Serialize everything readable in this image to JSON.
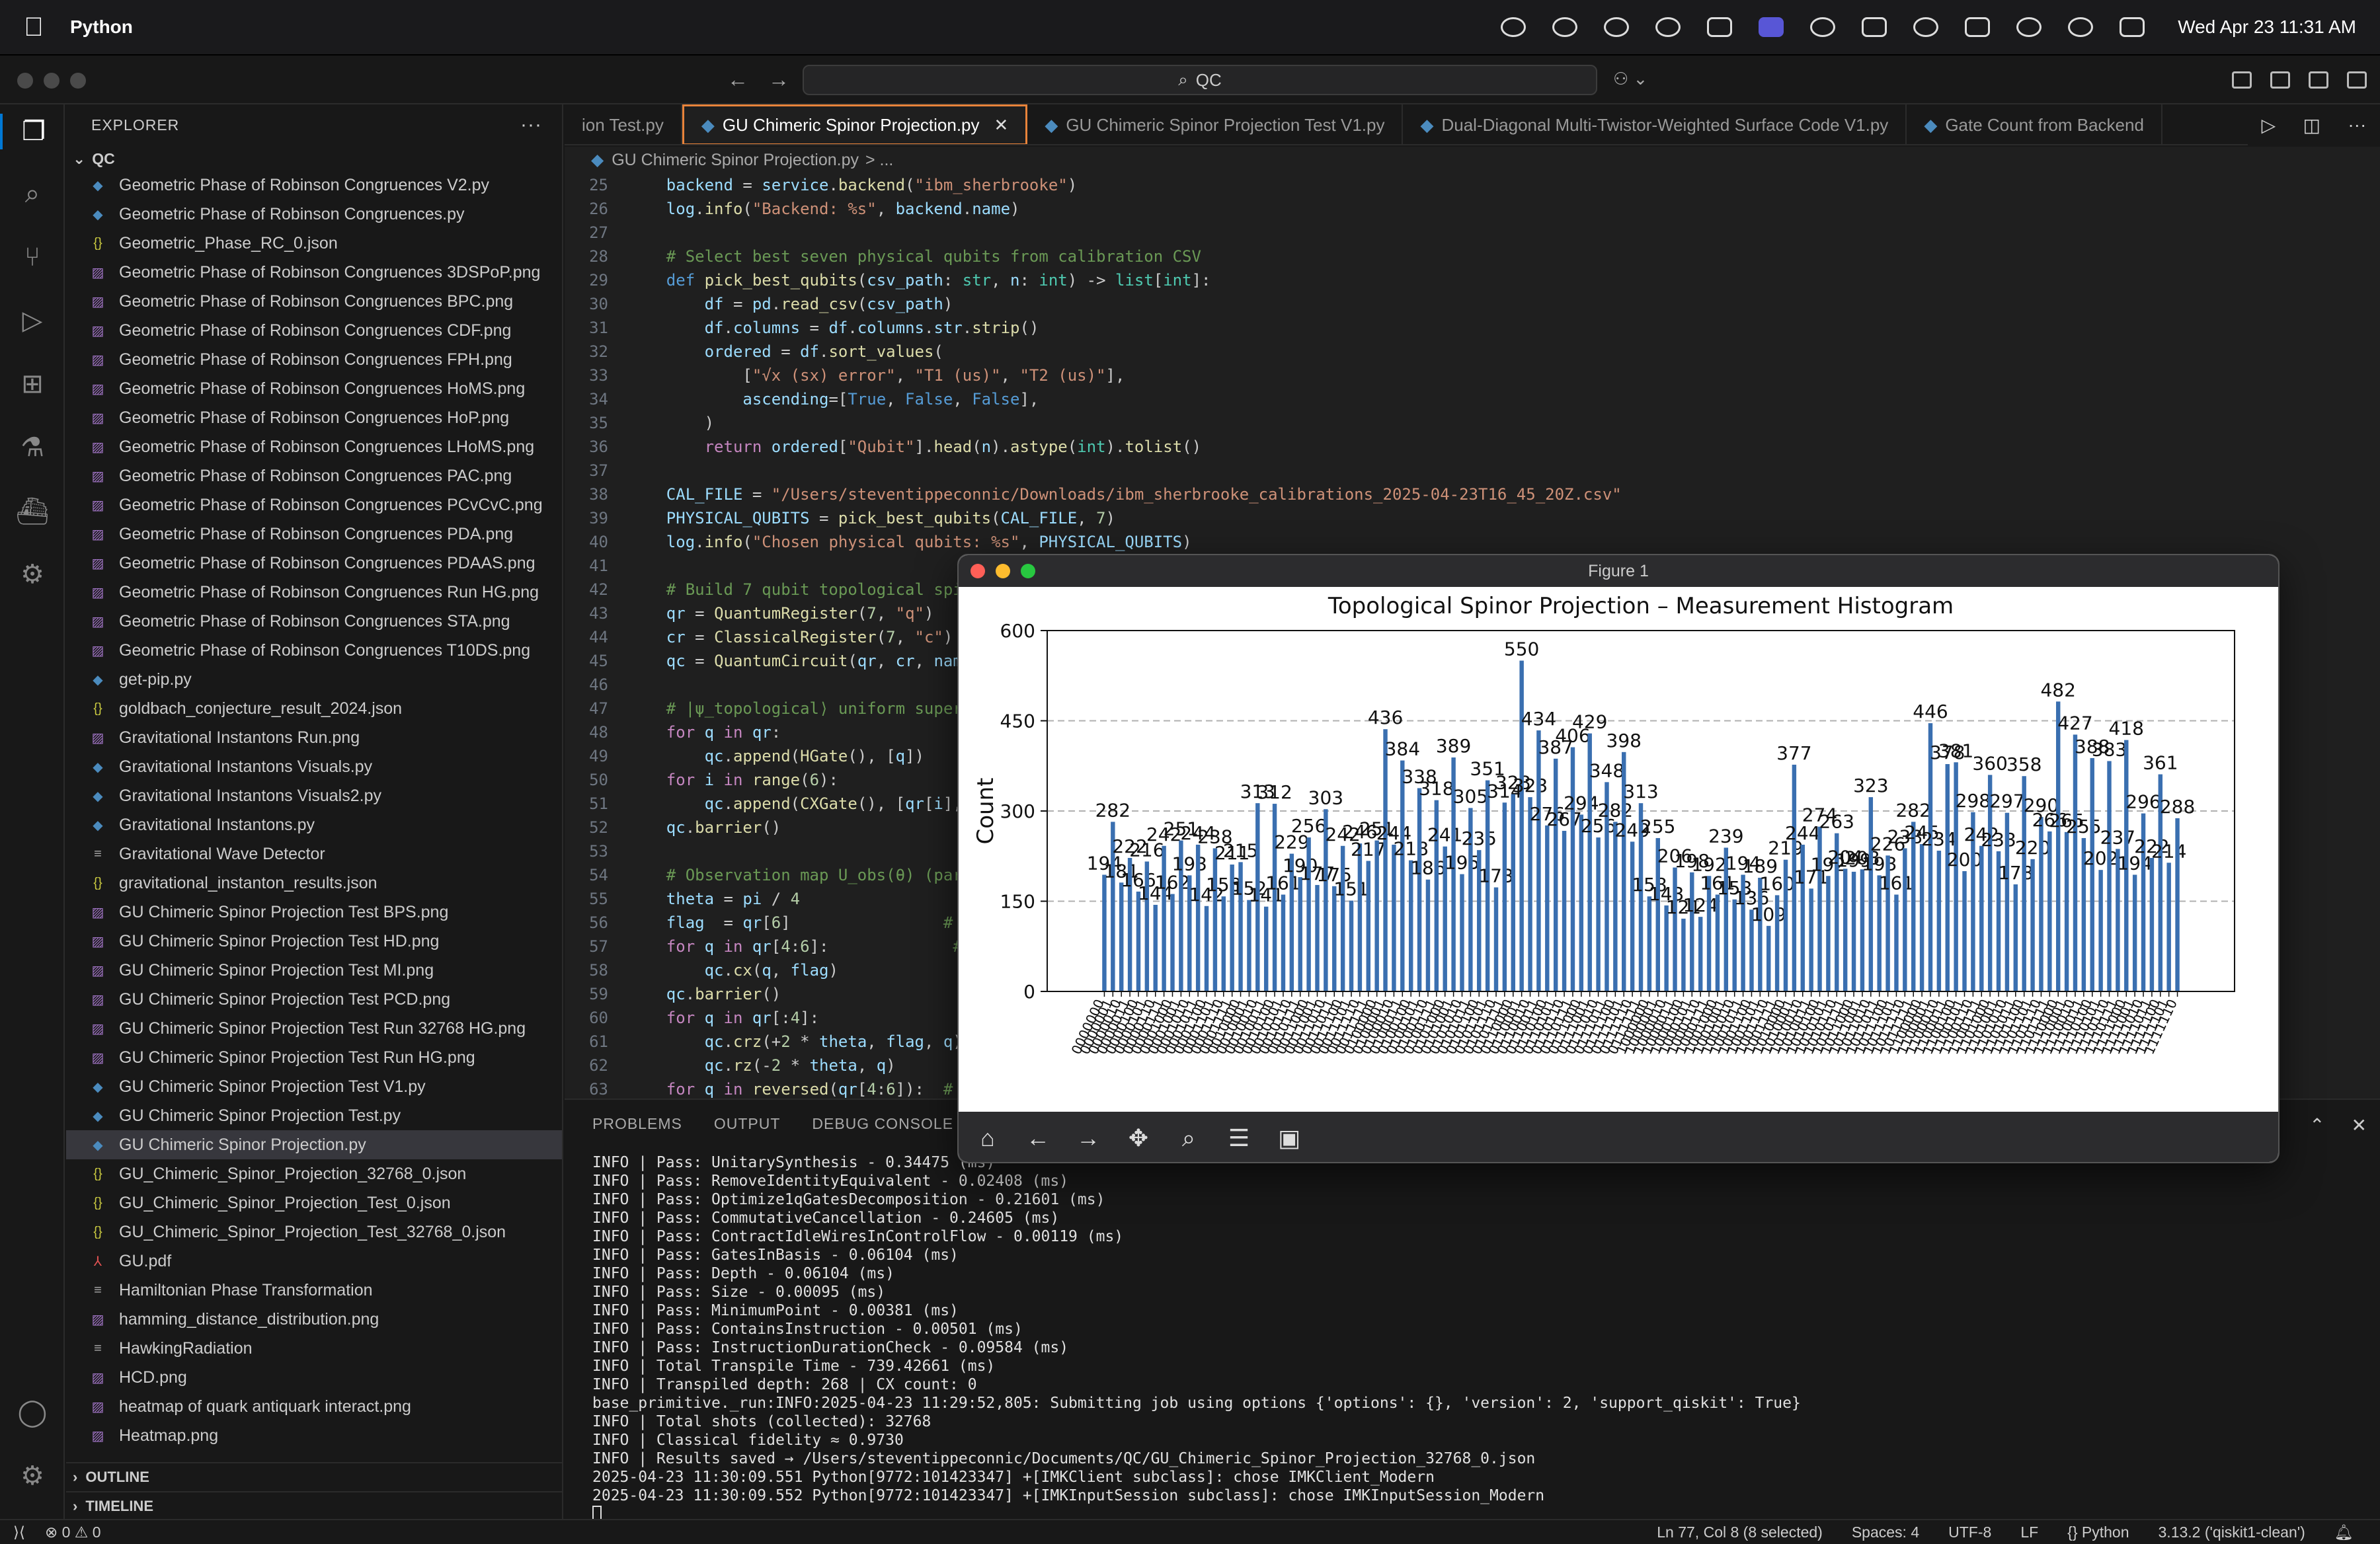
{
  "menubar": {
    "app_name": "Python",
    "clock": "Wed Apr 23  11:31 AM"
  },
  "titlebar": {
    "search_text": "QC",
    "back": "←",
    "forward": "→",
    "copilot": "⚇ ⌄"
  },
  "explorer": {
    "header": "EXPLORER",
    "more": "···",
    "folder": "QC",
    "files": [
      {
        "name": "Geometric Phase of Robinson Congruences V2.py",
        "type": "py"
      },
      {
        "name": "Geometric Phase of Robinson Congruences.py",
        "type": "py"
      },
      {
        "name": "Geometric_Phase_RC_0.json",
        "type": "json"
      },
      {
        "name": "Geometric Phase of Robinson Congruences 3DSPoP.png",
        "type": "png"
      },
      {
        "name": "Geometric Phase of Robinson Congruences BPC.png",
        "type": "png"
      },
      {
        "name": "Geometric Phase of Robinson Congruences CDF.png",
        "type": "png"
      },
      {
        "name": "Geometric Phase of Robinson Congruences FPH.png",
        "type": "png"
      },
      {
        "name": "Geometric Phase of Robinson Congruences HoMS.png",
        "type": "png"
      },
      {
        "name": "Geometric Phase of Robinson Congruences HoP.png",
        "type": "png"
      },
      {
        "name": "Geometric Phase of Robinson Congruences LHoMS.png",
        "type": "png"
      },
      {
        "name": "Geometric Phase of Robinson Congruences PAC.png",
        "type": "png"
      },
      {
        "name": "Geometric Phase of Robinson Congruences PCvCvC.png",
        "type": "png"
      },
      {
        "name": "Geometric Phase of Robinson Congruences PDA.png",
        "type": "png"
      },
      {
        "name": "Geometric Phase of Robinson Congruences PDAAS.png",
        "type": "png"
      },
      {
        "name": "Geometric Phase of Robinson Congruences Run HG.png",
        "type": "png"
      },
      {
        "name": "Geometric Phase of Robinson Congruences STA.png",
        "type": "png"
      },
      {
        "name": "Geometric Phase of Robinson Congruences T10DS.png",
        "type": "png"
      },
      {
        "name": "get-pip.py",
        "type": "py"
      },
      {
        "name": "goldbach_conjecture_result_2024.json",
        "type": "json"
      },
      {
        "name": "Gravitational Instantons Run.png",
        "type": "png"
      },
      {
        "name": "Gravitational Instantons Visuals.py",
        "type": "py"
      },
      {
        "name": "Gravitational Instantons Visuals2.py",
        "type": "py"
      },
      {
        "name": "Gravitational Instantons.py",
        "type": "py"
      },
      {
        "name": "Gravitational Wave Detector",
        "type": "txt"
      },
      {
        "name": "gravitational_instanton_results.json",
        "type": "json"
      },
      {
        "name": "GU Chimeric Spinor Projection Test BPS.png",
        "type": "png"
      },
      {
        "name": "GU Chimeric Spinor Projection Test HD.png",
        "type": "png"
      },
      {
        "name": "GU Chimeric Spinor Projection Test MI.png",
        "type": "png"
      },
      {
        "name": "GU Chimeric Spinor Projection Test PCD.png",
        "type": "png"
      },
      {
        "name": "GU Chimeric Spinor Projection Test Run 32768 HG.png",
        "type": "png"
      },
      {
        "name": "GU Chimeric Spinor Projection Test Run HG.png",
        "type": "png"
      },
      {
        "name": "GU Chimeric Spinor Projection Test V1.py",
        "type": "py"
      },
      {
        "name": "GU Chimeric Spinor Projection Test.py",
        "type": "py"
      },
      {
        "name": "GU Chimeric Spinor Projection.py",
        "type": "py",
        "selected": true
      },
      {
        "name": "GU_Chimeric_Spinor_Projection_32768_0.json",
        "type": "json"
      },
      {
        "name": "GU_Chimeric_Spinor_Projection_Test_0.json",
        "type": "json"
      },
      {
        "name": "GU_Chimeric_Spinor_Projection_Test_32768_0.json",
        "type": "json"
      },
      {
        "name": "GU.pdf",
        "type": "pdf"
      },
      {
        "name": "Hamiltonian Phase Transformation",
        "type": "txt"
      },
      {
        "name": "hamming_distance_distribution.png",
        "type": "png"
      },
      {
        "name": "HawkingRadiation",
        "type": "txt"
      },
      {
        "name": "HCD.png",
        "type": "png"
      },
      {
        "name": "heatmap of quark antiquark interact.png",
        "type": "png"
      },
      {
        "name": "Heatmap.png",
        "type": "png"
      }
    ],
    "outline": "OUTLINE",
    "timeline": "TIMELINE"
  },
  "tabs": [
    {
      "label": "ion Test.py",
      "active": false
    },
    {
      "label": "GU Chimeric Spinor Projection.py",
      "active": true
    },
    {
      "label": "GU Chimeric Spinor Projection Test V1.py",
      "active": false
    },
    {
      "label": "Dual-Diagonal Multi-Twistor-Weighted Surface Code V1.py",
      "active": false
    },
    {
      "label": "Gate Count from Backend",
      "active": false
    }
  ],
  "breadcrumb": {
    "file": "GU Chimeric Spinor Projection.py",
    "rest": "> ..."
  },
  "panel": {
    "tabs": [
      "PROBLEMS",
      "OUTPUT",
      "DEBUG CONSOLE"
    ],
    "terminal": [
      "INFO | Pass: UnitarySynthesis - 0.34475 (ms)",
      "INFO | Pass: RemoveIdentityEquivalent - 0.02408 (ms)",
      "INFO | Pass: Optimize1qGatesDecomposition - 0.21601 (ms)",
      "INFO | Pass: CommutativeCancellation - 0.24605 (ms)",
      "INFO | Pass: ContractIdleWiresInControlFlow - 0.00119 (ms)",
      "INFO | Pass: GatesInBasis - 0.06104 (ms)",
      "INFO | Pass: Depth - 0.06104 (ms)",
      "INFO | Pass: Size - 0.00095 (ms)",
      "INFO | Pass: MinimumPoint - 0.00381 (ms)",
      "INFO | Pass: ContainsInstruction - 0.00501 (ms)",
      "INFO | Pass: InstructionDurationCheck - 0.09584 (ms)",
      "INFO | Total Transpile Time - 739.42661 (ms)",
      "INFO | Transpiled depth: 268 | CX count: 0",
      "base_primitive._run:INFO:2025-04-23 11:29:52,805: Submitting job using options {'options': {}, 'version': 2, 'support_qiskit': True}",
      "INFO | Total shots (collected): 32768",
      "INFO | Classical fidelity ≈ 0.9730",
      "INFO | Results saved → /Users/steventippeconnic/Documents/QC/GU_Chimeric_Spinor_Projection_32768_0.json",
      "2025-04-23 11:30:09.551 Python[9772:101423347] +[IMKClient subclass]: chose IMKClient_Modern",
      "2025-04-23 11:30:09.552 Python[9772:101423347] +[IMKInputSession subclass]: chose IMKInputSession_Modern"
    ]
  },
  "statusbar": {
    "errors": "⊗ 0 ⚠ 0",
    "position": "Ln 77, Col 8 (8 selected)",
    "spaces": "Spaces: 4",
    "encoding": "UTF-8",
    "eol": "LF",
    "language": "{} Python",
    "interpreter": "3.13.2 ('qiskit1-clean')"
  },
  "figure": {
    "window_title": "Figure 1",
    "toolbar": [
      "home-icon",
      "back-icon",
      "forward-icon",
      "pan-icon",
      "zoom-icon",
      "configure-icon",
      "save-icon"
    ]
  },
  "chart_data": {
    "type": "bar",
    "title": "Topological Spinor Projection – Measurement Histogram",
    "xlabel": "",
    "ylabel": "Count",
    "ylim": [
      0,
      600
    ],
    "yticks": [
      0,
      150,
      300,
      450,
      600
    ],
    "grid": "y-dashed",
    "color": "#3a6fb0",
    "values": [
      194,
      282,
      181,
      222,
      166,
      216,
      144,
      242,
      162,
      251,
      193,
      244,
      142,
      238,
      158,
      211,
      215,
      152,
      313,
      141,
      312,
      161,
      229,
      190,
      256,
      177,
      303,
      175,
      242,
      151,
      246,
      217,
      251,
      436,
      244,
      384,
      218,
      338,
      186,
      318,
      241,
      389,
      195,
      305,
      235,
      351,
      173,
      314,
      328,
      550,
      323,
      434,
      276,
      387,
      267,
      406,
      294,
      429,
      256,
      348,
      282,
      398,
      249,
      313,
      158,
      255,
      143,
      206,
      121,
      198,
      124,
      192,
      161,
      239,
      153,
      194,
      136,
      189,
      109,
      160,
      219,
      377,
      244,
      171,
      274,
      192,
      263,
      204,
      199,
      203,
      323,
      193,
      226,
      161,
      238,
      282,
      245,
      446,
      234,
      378,
      381,
      200,
      298,
      242,
      360,
      233,
      297,
      178,
      358,
      220,
      290,
      266,
      482,
      265,
      427,
      255,
      388,
      202,
      383,
      237,
      418,
      194,
      296,
      222,
      361,
      214,
      288
    ]
  }
}
